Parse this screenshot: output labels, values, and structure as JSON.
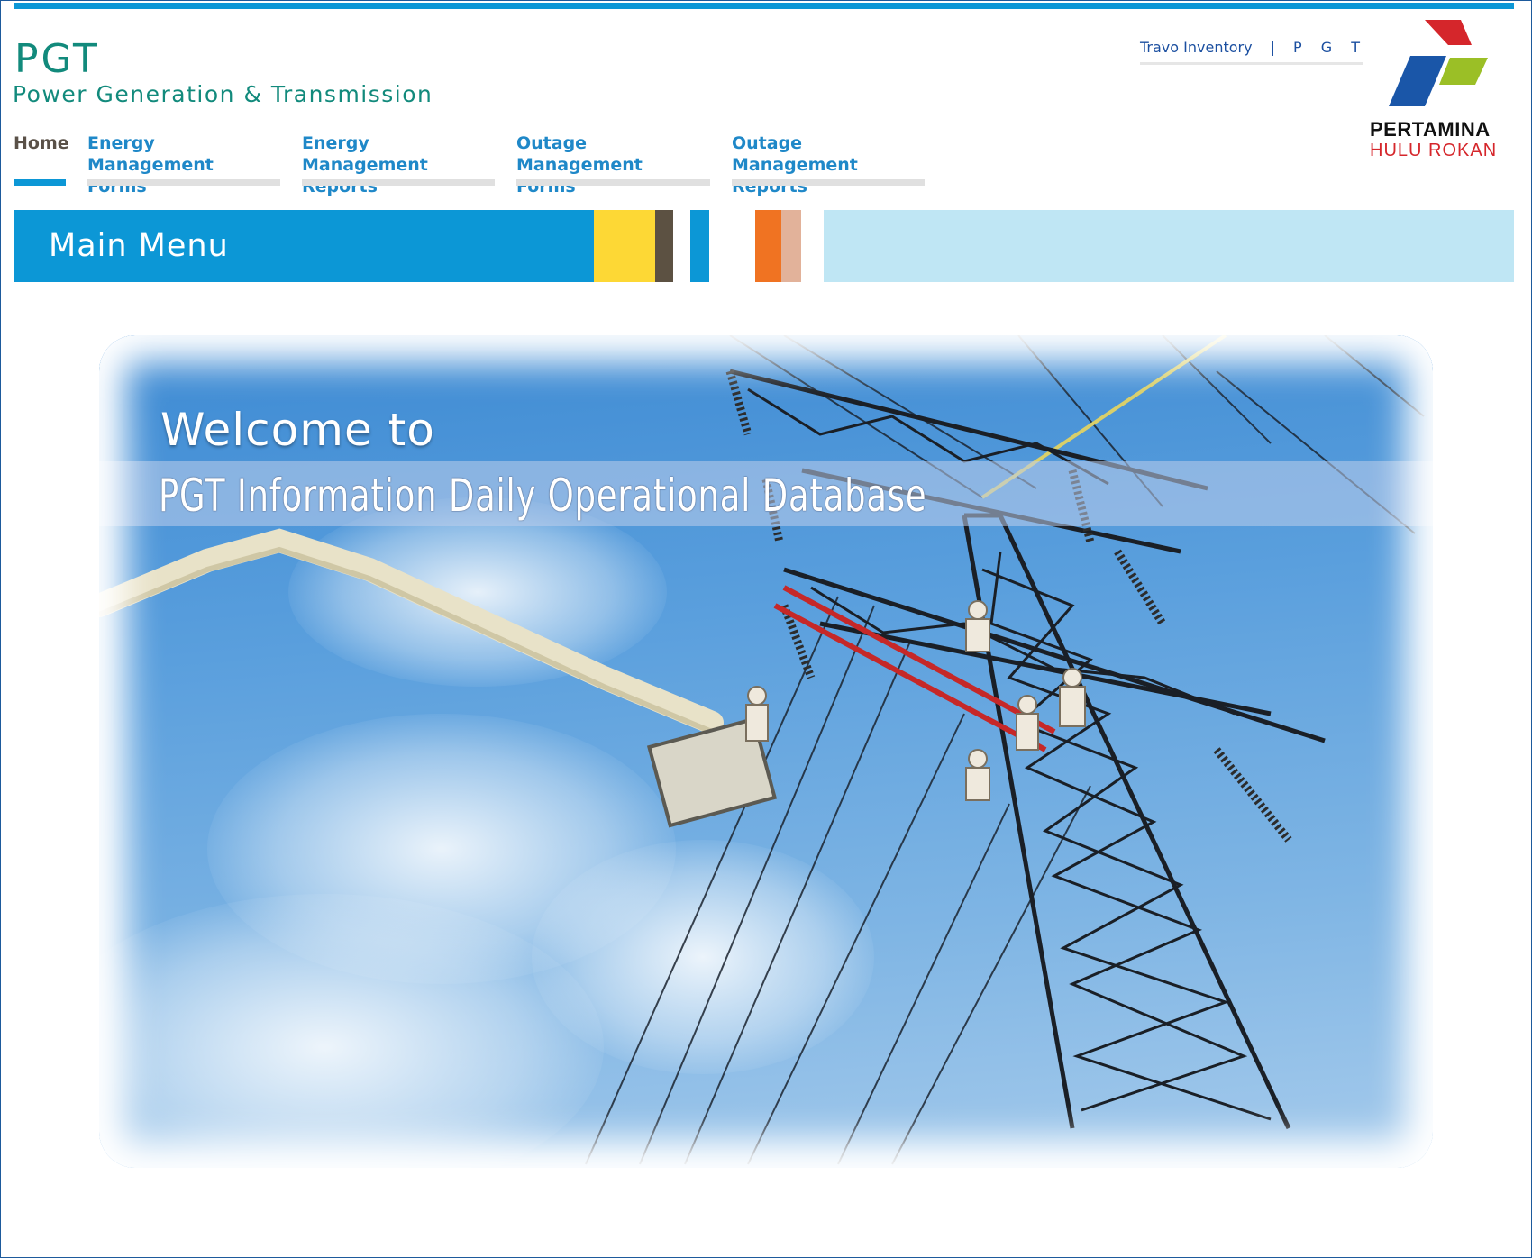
{
  "header": {
    "title": "PGT",
    "subtitle": "Power Generation & Transmission",
    "top_links": [
      "Travo Inventory",
      "P G T"
    ],
    "top_sep": "|",
    "logo": {
      "name": "PERTAMINA",
      "sub": "HULU ROKAN",
      "icon": "pertamina-logo"
    }
  },
  "nav": {
    "items": [
      {
        "label": "Home",
        "active": true
      },
      {
        "label": "Energy Management\nForms",
        "line1": "Energy Management",
        "line2": "Forms"
      },
      {
        "label": "Energy Management Reports",
        "line1": "Energy Management",
        "line2": "Reports"
      },
      {
        "label": "Outage Management Forms",
        "line1": "Outage Management",
        "line2": "Forms"
      },
      {
        "label": "Outage Management Reports",
        "line1": "Outage Management",
        "line2": "Reports"
      }
    ]
  },
  "menubar": {
    "title": "Main Menu",
    "colors": {
      "main": "#0c97d6",
      "yellow": "#fdd835",
      "brown": "#5c5142",
      "blue": "#0c97d6",
      "orange": "#f07322",
      "tan": "#e2b29a",
      "light": "#bfe6f4"
    }
  },
  "hero": {
    "welcome": "Welcome to",
    "title": "PGT Information Daily Operational Database",
    "image": "transmission-tower-line-workers-photo"
  },
  "colors": {
    "accent": "#0c97d6",
    "brand_text": "#128a7c",
    "nav_link": "#1f88c8",
    "logo_red": "#d5262b"
  }
}
